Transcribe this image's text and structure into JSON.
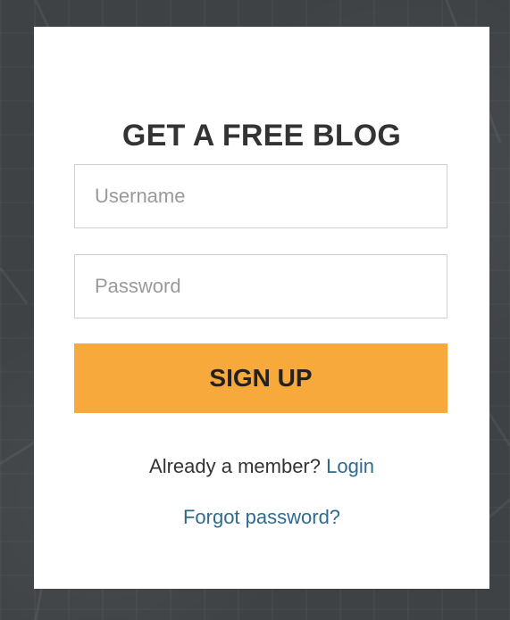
{
  "signup_card": {
    "title": "GET A FREE BLOG",
    "username_placeholder": "Username",
    "password_placeholder": "Password",
    "signup_label": "SIGN UP",
    "member_prompt": "Already a member?",
    "login_link": "Login",
    "forgot_link": "Forgot password?"
  },
  "colors": {
    "background": "#3f4245",
    "card": "#ffffff",
    "button": "#f7a93b",
    "link": "#2f6b8f"
  }
}
